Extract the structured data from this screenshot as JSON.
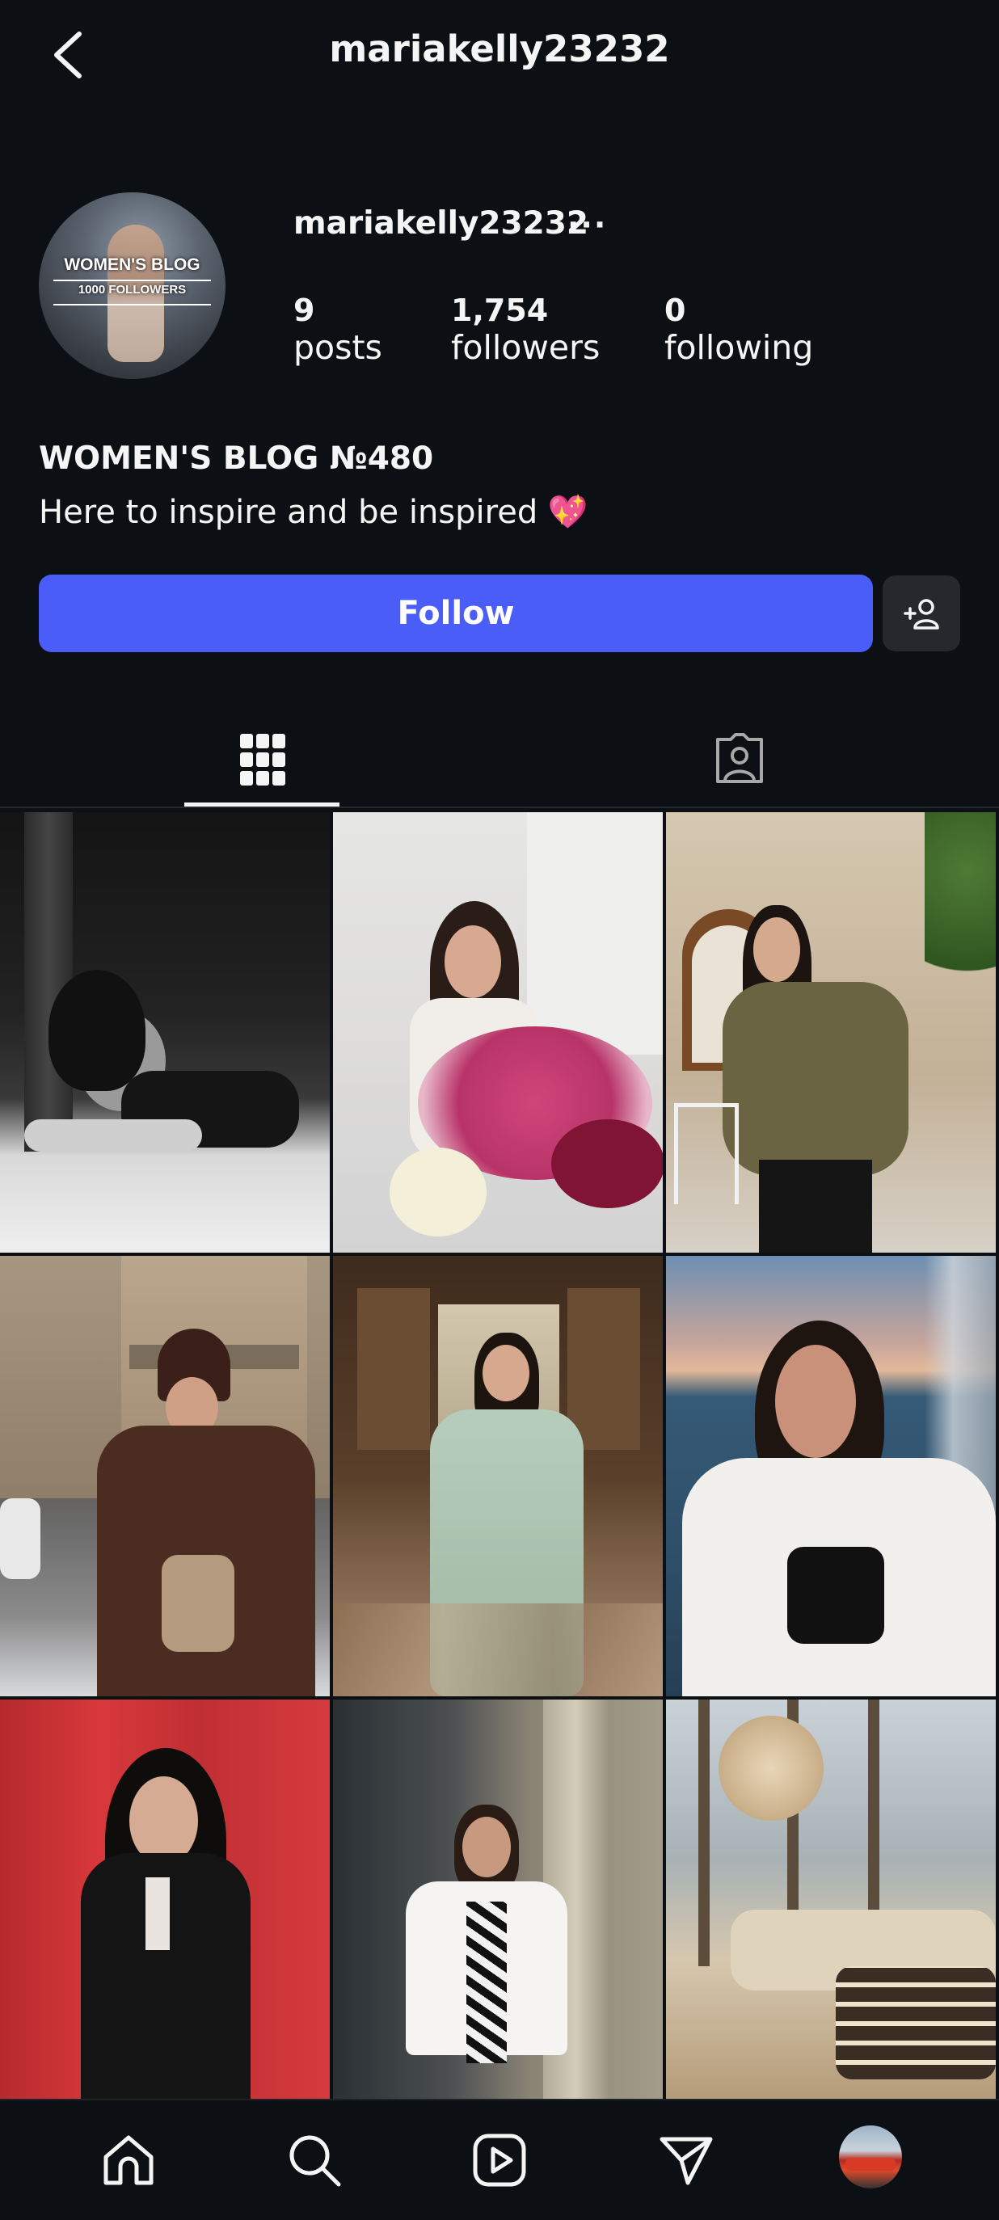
{
  "header": {
    "title": "mariakelly23232",
    "back_icon": "chevron-left-icon"
  },
  "profile": {
    "avatar_text_1": "WOMEN'S BLOG",
    "avatar_text_2": "1000 FOLLOWERS",
    "username": "mariakelly23232",
    "more_label": "···",
    "stats": {
      "posts": {
        "value": "9",
        "label": "posts"
      },
      "followers": {
        "value": "1,754",
        "label": "followers"
      },
      "following": {
        "value": "0",
        "label": "following"
      }
    },
    "bio_name": "WOMEN'S BLOG №480",
    "bio_text": "Here to inspire and be inspired 💖",
    "follow_label": "Follow",
    "suggest_icon": "add-person-icon"
  },
  "tabs": [
    {
      "name": "posts-grid",
      "icon": "grid-icon",
      "active": true
    },
    {
      "name": "tagged",
      "icon": "tagged-person-icon",
      "active": false
    }
  ],
  "posts": [
    "photo-1",
    "photo-2",
    "photo-3",
    "photo-4",
    "photo-5",
    "photo-6",
    "photo-7",
    "photo-8",
    "photo-9"
  ],
  "bottom_nav": [
    "home-icon",
    "search-icon",
    "reels-icon",
    "direct-message-icon",
    "profile-avatar"
  ],
  "colors": {
    "background": "#0c1014",
    "accent": "#4a5df9",
    "secondary_button": "#25292e"
  }
}
